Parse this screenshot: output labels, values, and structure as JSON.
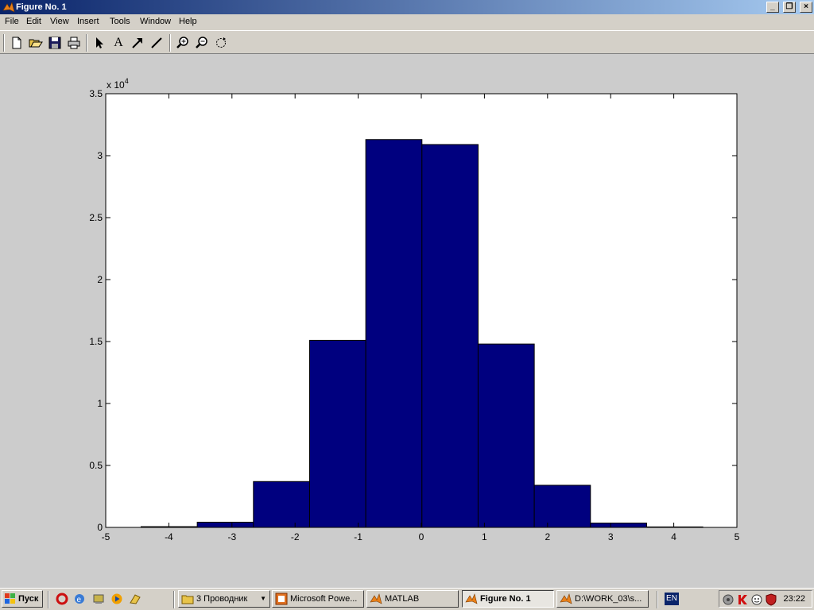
{
  "window": {
    "title": "Figure No. 1",
    "buttons": {
      "minimize": "_",
      "maximize": "❐",
      "close": "×"
    }
  },
  "menu": [
    "File",
    "Edit",
    "View",
    "Insert",
    "Tools",
    "Window",
    "Help"
  ],
  "toolbar": {
    "icons": [
      "new-figure-icon",
      "open-file-icon",
      "save-icon",
      "print-icon",
      "select-arrow-icon",
      "insert-text-icon",
      "insert-arrow-icon",
      "insert-line-icon",
      "zoom-in-icon",
      "zoom-out-icon",
      "rotate-3d-icon"
    ],
    "text_tool_glyph": "A"
  },
  "chart_data": {
    "type": "bar",
    "x": [
      -4,
      -3,
      -2,
      -1,
      0,
      1,
      2,
      3,
      4
    ],
    "bin_edges": [
      -4.44,
      -3.55,
      -2.66,
      -1.77,
      -0.88,
      0.01,
      0.9,
      1.79,
      2.68,
      3.57,
      4.46
    ],
    "values": [
      60,
      420,
      3700,
      15100,
      31300,
      30900,
      14800,
      3400,
      350,
      40
    ],
    "xlim": [
      -5,
      5
    ],
    "ylim": [
      0,
      35000
    ],
    "xticks": [
      "-5",
      "-4",
      "-3",
      "-2",
      "-1",
      "0",
      "1",
      "2",
      "3",
      "4",
      "5"
    ],
    "yticks": [
      "0",
      "0.5",
      "1",
      "1.5",
      "2",
      "2.5",
      "3",
      "3.5"
    ],
    "y_multiplier": "x 10",
    "y_multiplier_exp": "4",
    "bar_color": "#00007f",
    "grid": false
  },
  "taskbar": {
    "start_label": "Пуск",
    "tasks": [
      {
        "label": "3 Проводник",
        "icon": "folder-icon"
      },
      {
        "label": "Microsoft Powe...",
        "icon": "powerpoint-icon"
      },
      {
        "label": "MATLAB",
        "icon": "matlab-icon"
      },
      {
        "label": "Figure No. 1",
        "icon": "matlab-icon",
        "active": true
      },
      {
        "label": "D:\\WORK_03\\s...",
        "icon": "matlab-icon"
      }
    ],
    "language": "EN",
    "clock": "23:22"
  }
}
